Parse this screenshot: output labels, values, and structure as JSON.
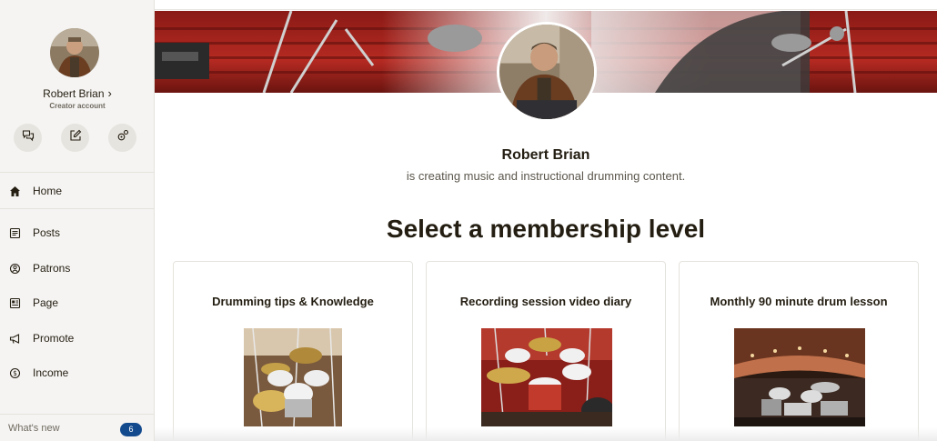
{
  "sidebar": {
    "creator_name": "Robert Brian",
    "creator_chevron": "›",
    "creator_type": "Creator account",
    "quick_actions": [
      {
        "icon": "chat-bubbles-icon"
      },
      {
        "icon": "edit-post-icon"
      },
      {
        "icon": "settings-gear-icon"
      }
    ],
    "nav": [
      {
        "label": "Home",
        "icon": "home-icon"
      },
      {
        "label": "Posts",
        "icon": "posts-icon"
      },
      {
        "label": "Patrons",
        "icon": "patrons-icon"
      },
      {
        "label": "Page",
        "icon": "page-icon"
      },
      {
        "label": "Promote",
        "icon": "megaphone-icon"
      },
      {
        "label": "Income",
        "icon": "dollar-circle-icon"
      }
    ],
    "whats_new": {
      "label": "What's new",
      "count": "6"
    }
  },
  "page": {
    "name": "Robert Brian",
    "tagline": "is creating music and instructional drumming content.",
    "section_title": "Select a membership level"
  },
  "tiers": [
    {
      "title": "Drumming tips & Knowledge"
    },
    {
      "title": "Recording session video diary"
    },
    {
      "title": "Monthly 90 minute drum lesson"
    }
  ],
  "colors": {
    "accent_badge": "#134a8e",
    "sidebar_bg": "#f5f4f2",
    "text": "#241e12"
  }
}
